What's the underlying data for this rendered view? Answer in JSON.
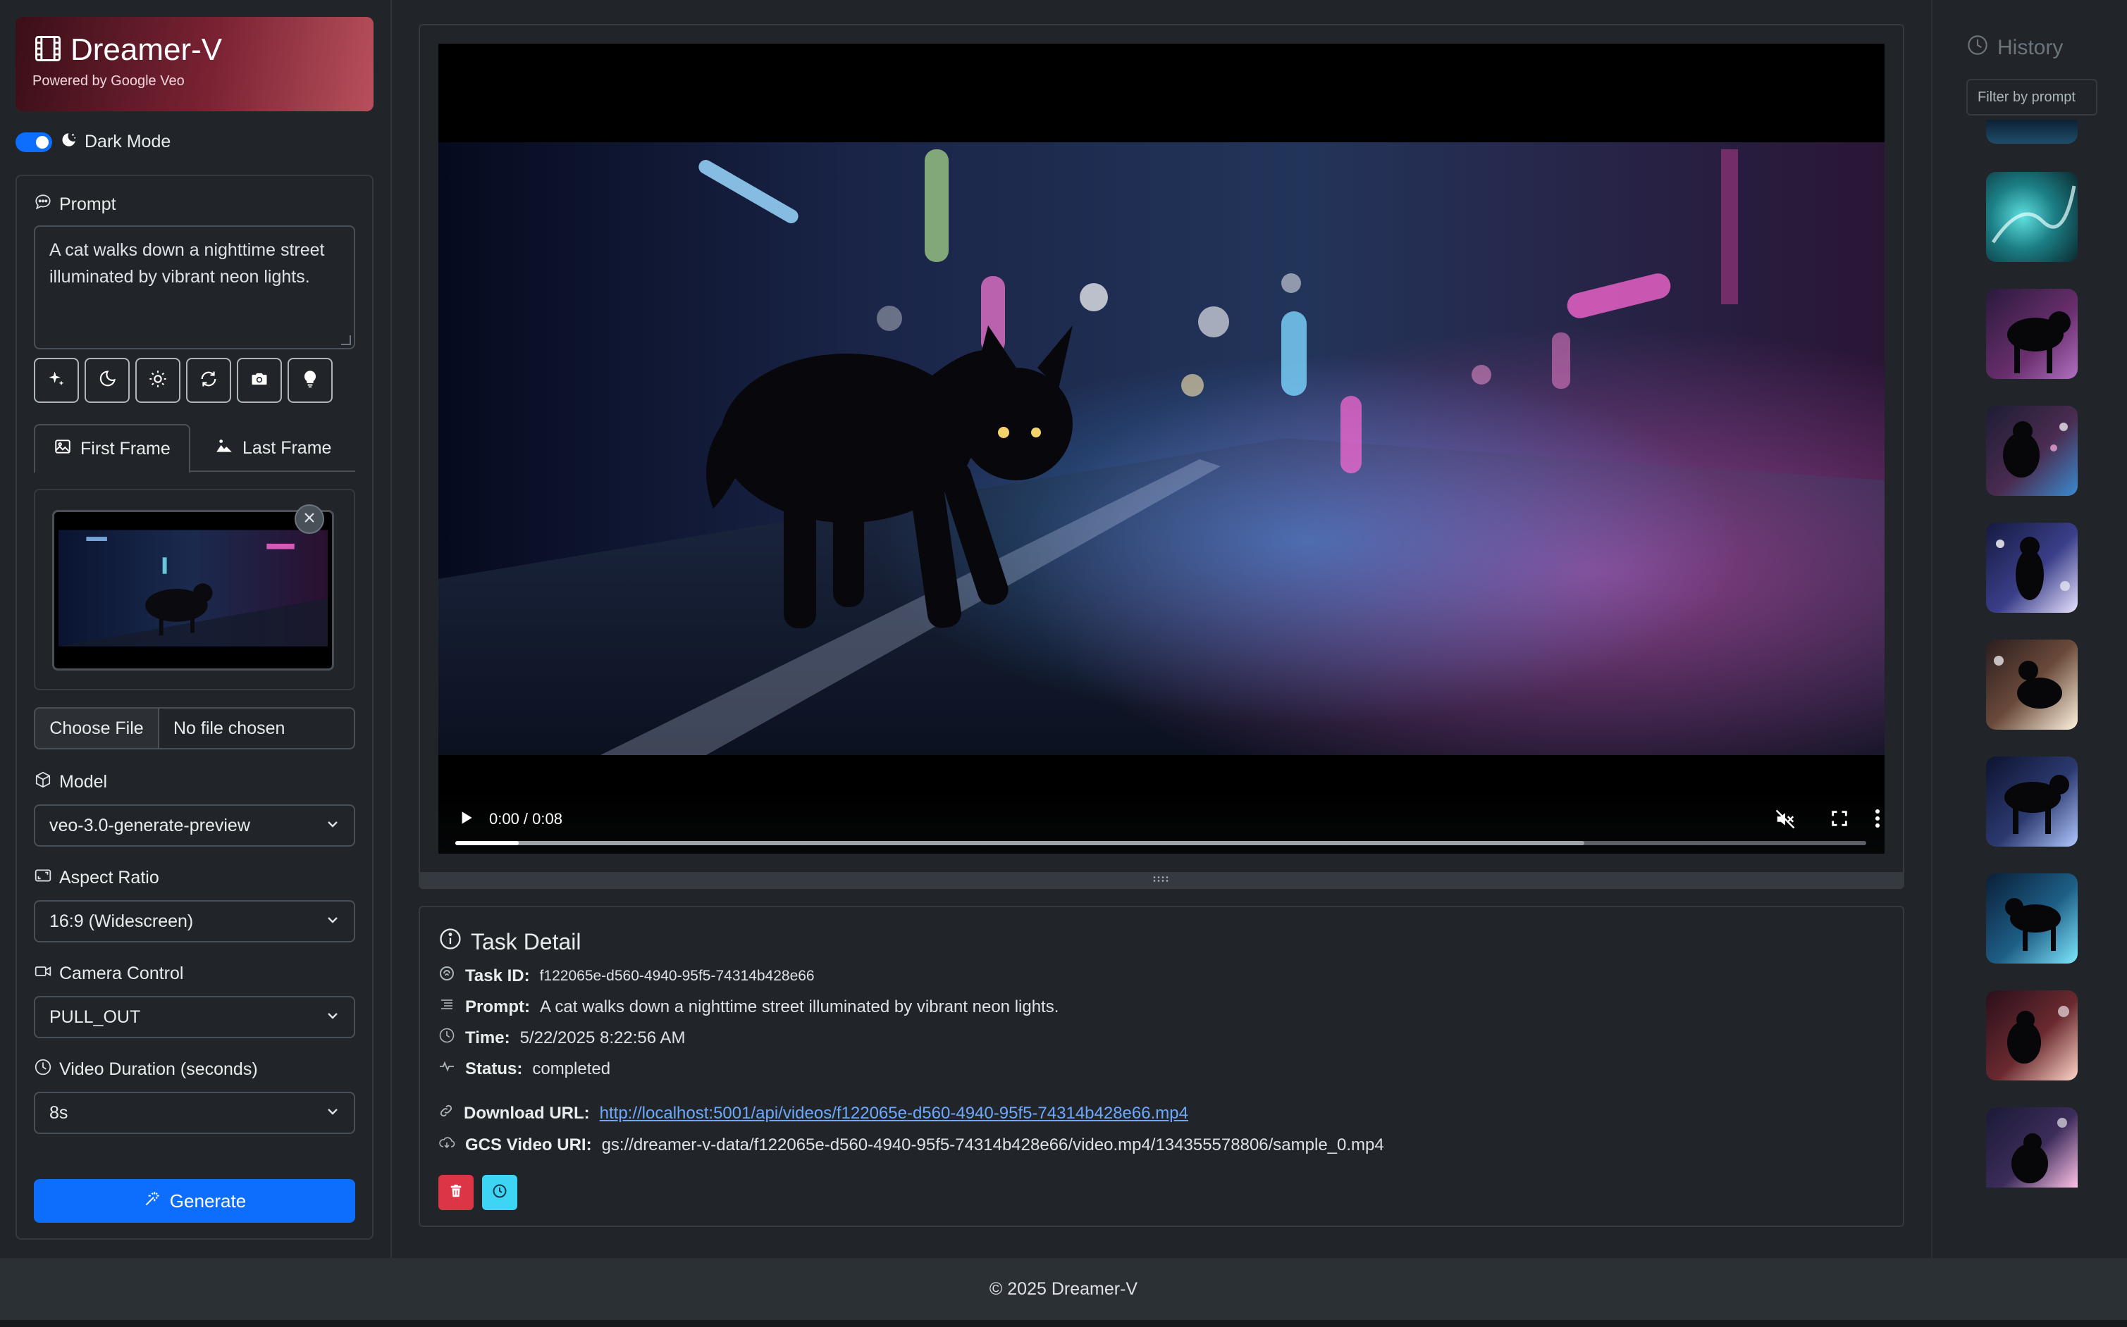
{
  "brand": {
    "title": "Dreamer-V",
    "subtitle": "Powered by Google Veo"
  },
  "dark_mode": {
    "label": "Dark Mode",
    "enabled": true
  },
  "prompt": {
    "label": "Prompt",
    "value": "A cat walks down a nighttime street illuminated by vibrant neon lights.",
    "quick_actions": [
      "sparkles-icon",
      "moon-icon",
      "sun-icon",
      "refresh-icon",
      "camera-icon",
      "lightbulb-icon"
    ]
  },
  "frames": {
    "tabs": [
      {
        "label": "First Frame",
        "icon": "image-icon",
        "active": true
      },
      {
        "label": "Last Frame",
        "icon": "images-icon",
        "active": false
      }
    ],
    "file_button": "Choose File",
    "file_name": "No file chosen"
  },
  "model": {
    "label": "Model",
    "value": "veo-3.0-generate-preview"
  },
  "aspect_ratio": {
    "label": "Aspect Ratio",
    "value": "16:9 (Widescreen)"
  },
  "camera_control": {
    "label": "Camera Control",
    "value": "PULL_OUT"
  },
  "duration": {
    "label": "Video Duration (seconds)",
    "value": "8s"
  },
  "generate_label": "Generate",
  "player": {
    "time": "0:00 / 0:08",
    "played_fraction": 0.045,
    "buffered_fraction": 0.8
  },
  "task": {
    "title": "Task Detail",
    "id_label": "Task ID:",
    "id": "f122065e-d560-4940-95f5-74314b428e66",
    "prompt_label": "Prompt:",
    "prompt": "A cat walks down a nighttime street illuminated by vibrant neon lights.",
    "time_label": "Time:",
    "time": "5/22/2025 8:22:56 AM",
    "status_label": "Status:",
    "status": "completed",
    "download_label": "Download URL:",
    "download_url": "http://localhost:5001/api/videos/f122065e-d560-4940-95f5-74314b428e66.mp4",
    "gcs_label": "GCS Video URI:",
    "gcs_uri": "gs://dreamer-v-data/f122065e-d560-4940-95f5-74314b428e66/video.mp4/134355578806/sample_0.mp4"
  },
  "history": {
    "title": "History",
    "filter_placeholder": "Filter by prompt"
  },
  "footer": "© 2025 Dreamer-V",
  "colors": {
    "background": "#212529",
    "primary": "#0d6efd",
    "danger": "#dc3545",
    "info": "#0dcaf0",
    "link": "#6ea8fe"
  }
}
